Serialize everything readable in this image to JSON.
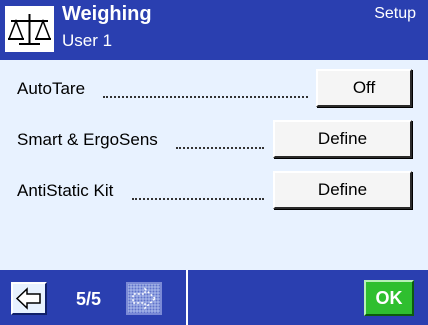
{
  "header": {
    "icon": "balance-scale-icon",
    "title": "Weighing",
    "subtitle": "User 1",
    "mode": "Setup"
  },
  "settings": [
    {
      "label": "AutoTare",
      "value": "Off"
    },
    {
      "label": "Smart & ErgoSens",
      "value": "Define"
    },
    {
      "label": "AntiStatic Kit",
      "value": "Define"
    }
  ],
  "footer": {
    "prev_icon": "arrow-left-icon",
    "page_indicator": "5/5",
    "next_icon": "arrow-right-icon",
    "next_enabled": false,
    "ok_label": "OK"
  },
  "colors": {
    "header_bg": "#2a3fb0",
    "content_bg": "#e8f2ff",
    "ok_green": "#2fbf2f"
  }
}
